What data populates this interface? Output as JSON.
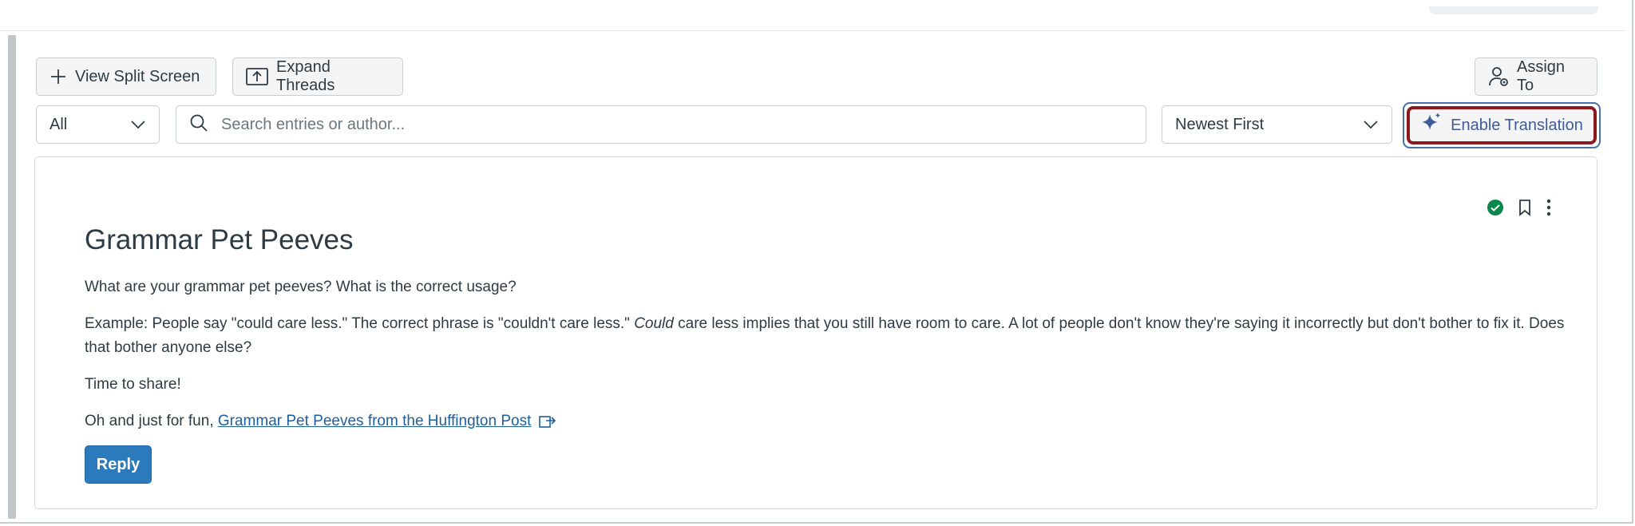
{
  "toolbar": {
    "split_screen_label": "View Split Screen",
    "expand_threads_label": "Expand Threads",
    "assign_to_label": "Assign To"
  },
  "filters": {
    "scope_value": "All",
    "search_placeholder": "Search entries or author...",
    "sort_value": "Newest First",
    "translation_label": "Enable Translation"
  },
  "post": {
    "title": "Grammar Pet Peeves",
    "paragraph1": "What are your grammar pet peeves? What is the correct usage?",
    "paragraph2_start": "Example: People say \"could care less.\" The correct phrase is \"couldn't care less.\" ",
    "paragraph2_emphasis": "Could",
    "paragraph2_end": " care less implies that you still have room to care. A lot of people don't know they're saying it incorrectly but don't bother to fix it. Does that bother anyone else?",
    "paragraph3": "Time to share!",
    "paragraph4_prefix": "Oh and just for fun, ",
    "link_text": "Grammar Pet Peeves from the Huffington Post",
    "reply_label": "Reply"
  },
  "colors": {
    "accent": "#2b7abc",
    "published_green": "#0b874b",
    "highlight_border": "#8b1a1f"
  },
  "icons": [
    "plus-icon",
    "expand-icon",
    "assign-user-icon",
    "chevron-down-icon",
    "search-icon",
    "sparkle-icon",
    "published-check-icon",
    "bookmark-icon",
    "kebab-menu-icon",
    "external-link-icon"
  ]
}
